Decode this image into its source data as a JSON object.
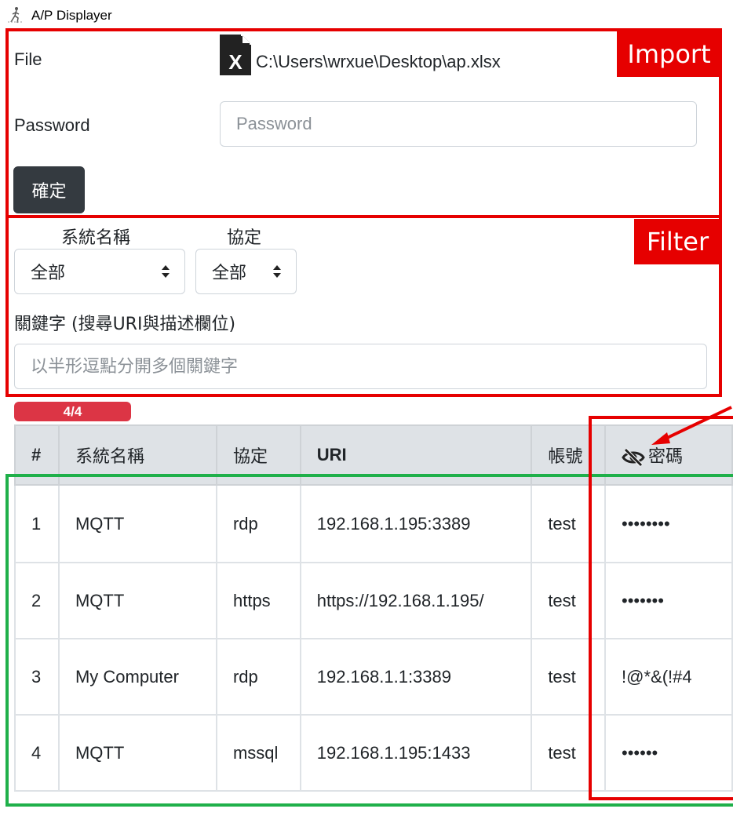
{
  "window": {
    "title": "A/P Displayer"
  },
  "annotations": {
    "import_tag": "Import",
    "filter_tag": "Filter"
  },
  "import": {
    "file_label": "File",
    "file_path": "C:\\Users\\wrxue\\Desktop\\ap.xlsx",
    "file_icon": "excel-file-icon",
    "password_label": "Password",
    "password_placeholder": "Password",
    "confirm_label": "確定"
  },
  "filter": {
    "system_label": "系統名稱",
    "system_value": "全部",
    "protocol_label": "協定",
    "protocol_value": "全部",
    "keyword_label": "關鍵字 (搜尋URI與描述欄位)",
    "keyword_placeholder": "以半形逗點分開多個關鍵字"
  },
  "result_count": "4/4",
  "table": {
    "headers": {
      "index": "#",
      "system": "系統名稱",
      "protocol": "協定",
      "uri": "URI",
      "account": "帳號",
      "password": "密碼"
    },
    "password_toggle_icon": "eye-slash-icon",
    "rows": [
      {
        "index": "1",
        "system": "MQTT",
        "protocol": "rdp",
        "uri": "192.168.1.195:3389",
        "account": "test",
        "password": "••••••••"
      },
      {
        "index": "2",
        "system": "MQTT",
        "protocol": "https",
        "uri": "https://192.168.1.195/",
        "account": "test",
        "password": "•••••••"
      },
      {
        "index": "3",
        "system": "My Computer",
        "protocol": "rdp",
        "uri": "192.168.1.1:3389",
        "account": "test",
        "password": "!@*&(!#4"
      },
      {
        "index": "4",
        "system": "MQTT",
        "protocol": "mssql",
        "uri": "192.168.1.195:1433",
        "account": "test",
        "password": "••••••"
      }
    ]
  },
  "colors": {
    "annotation_red": "#e60000",
    "annotation_green": "#1fb04a",
    "badge": "#dc3545",
    "button_dark": "#343a40",
    "table_header": "#dee2e6"
  }
}
